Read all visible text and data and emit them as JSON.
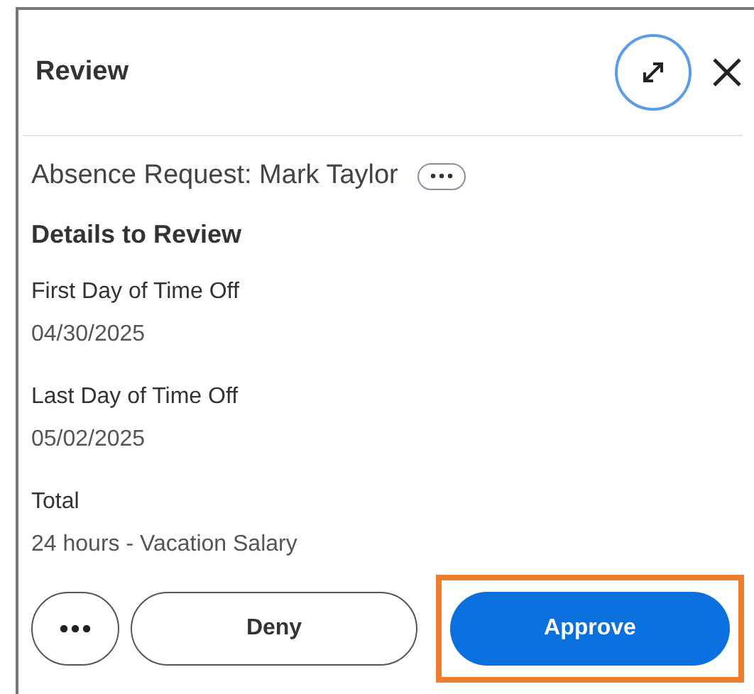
{
  "panel": {
    "title": "Review"
  },
  "request": {
    "title": "Absence Request: Mark Taylor"
  },
  "section": {
    "heading": "Details to Review"
  },
  "fields": [
    {
      "label": "First Day of Time Off",
      "value": "04/30/2025"
    },
    {
      "label": "Last Day of Time Off",
      "value": "05/02/2025"
    },
    {
      "label": "Total",
      "value": "24 hours - Vacation Salary"
    }
  ],
  "actions": [
    {
      "kind": "more",
      "highlighted": false
    },
    {
      "kind": "secondary",
      "label": "Deny",
      "highlighted": false
    },
    {
      "kind": "primary",
      "label": "Approve",
      "highlighted": true
    }
  ]
}
